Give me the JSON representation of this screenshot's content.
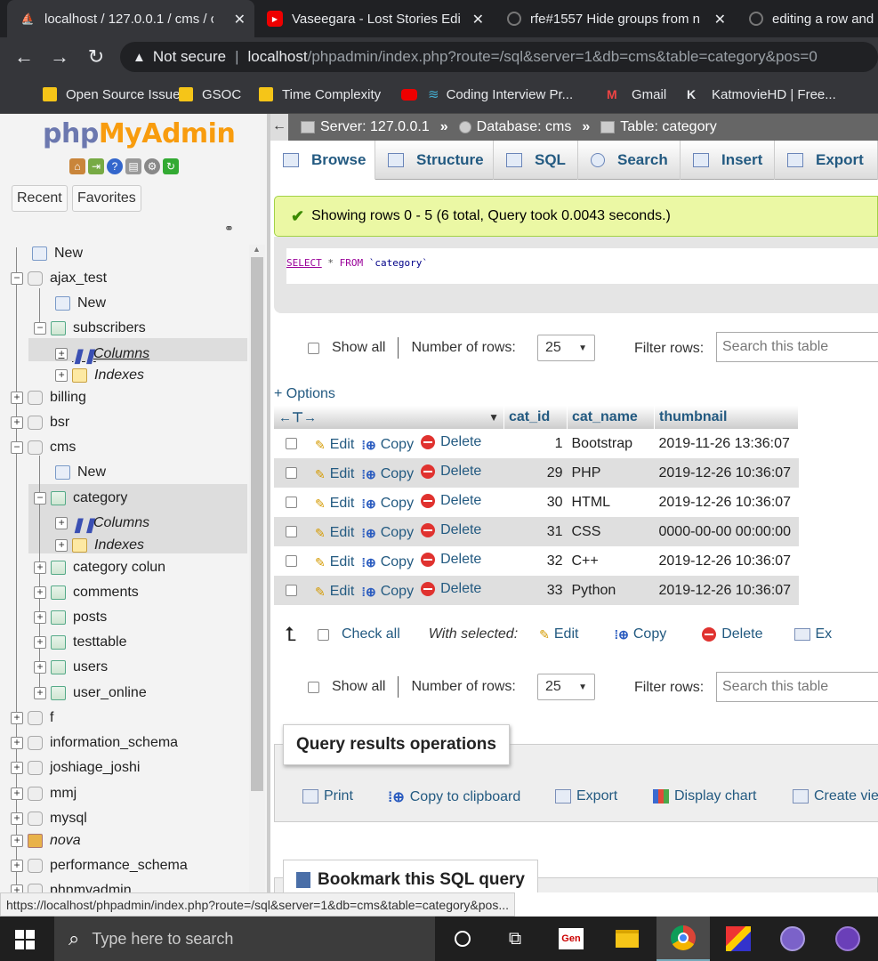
{
  "browser": {
    "tabs": [
      {
        "title": "localhost / 127.0.0.1 / cms / c",
        "icon": "phpmyadmin-icon",
        "active": true
      },
      {
        "title": "Vaseegara - Lost Stories Edit",
        "icon": "youtube-icon",
        "active": false
      },
      {
        "title": "rfe#1557 Hide groups from n",
        "icon": "github-icon",
        "active": false
      },
      {
        "title": "editing a row and",
        "icon": "github-icon",
        "active": false
      }
    ],
    "security_label": "Not secure",
    "url_host": "localhost",
    "url_rest": "/phpadmin/index.php?route=/sql&server=1&db=cms&table=category&pos=0",
    "bookmarks": [
      {
        "label": "Open Source Issues",
        "icon": "folder-icon"
      },
      {
        "label": "GSOC",
        "icon": "folder-icon"
      },
      {
        "label": "Time Complexity",
        "icon": "folder-icon"
      },
      {
        "label": "Coding Interview Pr...",
        "icon": "youtube-icon"
      },
      {
        "label": "Gmail",
        "icon": "gmail-icon"
      },
      {
        "label": "KatmovieHD | Free...",
        "icon": "k-icon"
      }
    ]
  },
  "sidebar": {
    "logo_php": "php",
    "logo_myadmin": "MyAdmin",
    "recent_label": "Recent",
    "favorites_label": "Favorites",
    "tree": [
      {
        "label": "New",
        "level": 0,
        "kind": "new"
      },
      {
        "label": "ajax_test",
        "level": 0,
        "kind": "db",
        "expanded": true
      },
      {
        "label": "New",
        "level": 1,
        "kind": "new"
      },
      {
        "label": "subscribers",
        "level": 1,
        "kind": "table",
        "expanded": true
      },
      {
        "label": "Columns",
        "level": 2,
        "kind": "columns"
      },
      {
        "label": "Indexes",
        "level": 2,
        "kind": "indexes"
      },
      {
        "label": "billing",
        "level": 0,
        "kind": "db"
      },
      {
        "label": "bsr",
        "level": 0,
        "kind": "db"
      },
      {
        "label": "cms",
        "level": 0,
        "kind": "db",
        "expanded": true
      },
      {
        "label": "New",
        "level": 1,
        "kind": "new"
      },
      {
        "label": "category",
        "level": 1,
        "kind": "table",
        "expanded": true
      },
      {
        "label": "Columns",
        "level": 2,
        "kind": "columns"
      },
      {
        "label": "Indexes",
        "level": 2,
        "kind": "indexes"
      },
      {
        "label": "category colun",
        "level": 1,
        "kind": "table"
      },
      {
        "label": "comments",
        "level": 1,
        "kind": "table"
      },
      {
        "label": "posts",
        "level": 1,
        "kind": "table"
      },
      {
        "label": "testtable",
        "level": 1,
        "kind": "table"
      },
      {
        "label": "users",
        "level": 1,
        "kind": "table"
      },
      {
        "label": "user_online",
        "level": 1,
        "kind": "table"
      },
      {
        "label": "f",
        "level": 0,
        "kind": "db"
      },
      {
        "label": "information_schema",
        "level": 0,
        "kind": "db"
      },
      {
        "label": "joshiage_joshi",
        "level": 0,
        "kind": "db"
      },
      {
        "label": "mmj",
        "level": 0,
        "kind": "db"
      },
      {
        "label": "mysql",
        "level": 0,
        "kind": "db"
      },
      {
        "label": "nova",
        "level": 0,
        "kind": "group"
      },
      {
        "label": "performance_schema",
        "level": 0,
        "kind": "db"
      },
      {
        "label": "phpmyadmin",
        "level": 0,
        "kind": "db"
      }
    ]
  },
  "breadcrumb": {
    "server": "Server: 127.0.0.1",
    "database": "Database: cms",
    "table": "Table: category"
  },
  "tabs": [
    {
      "label": "Browse",
      "icon": "browse-icon"
    },
    {
      "label": "Structure",
      "icon": "structure-icon"
    },
    {
      "label": "SQL",
      "icon": "sql-icon"
    },
    {
      "label": "Search",
      "icon": "search-icon"
    },
    {
      "label": "Insert",
      "icon": "insert-icon"
    },
    {
      "label": "Export",
      "icon": "export-icon"
    }
  ],
  "result": {
    "success_message": "Showing rows 0 - 5 (6 total, Query took 0.0043 seconds.)",
    "sql_select": "SELECT",
    "sql_star": "*",
    "sql_from": "FROM",
    "sql_table": "`category`"
  },
  "navigation": {
    "show_all_label": "Show all",
    "rows_label": "Number of rows:",
    "rows_value": "25",
    "filter_label": "Filter rows:",
    "filter_placeholder": "Search this table"
  },
  "options_label": "+ Options",
  "table": {
    "columns": [
      "cat_id",
      "cat_name",
      "thumbnail"
    ],
    "actions": {
      "edit": "Edit",
      "copy": "Copy",
      "delete": "Delete"
    },
    "rows": [
      {
        "cat_id": "1",
        "cat_name": "Bootstrap",
        "thumbnail": "2019-11-26 13:36:07"
      },
      {
        "cat_id": "29",
        "cat_name": "PHP",
        "thumbnail": "2019-12-26 10:36:07"
      },
      {
        "cat_id": "30",
        "cat_name": "HTML",
        "thumbnail": "2019-12-26 10:36:07"
      },
      {
        "cat_id": "31",
        "cat_name": "CSS",
        "thumbnail": "0000-00-00 00:00:00"
      },
      {
        "cat_id": "32",
        "cat_name": "C++",
        "thumbnail": "2019-12-26 10:36:07"
      },
      {
        "cat_id": "33",
        "cat_name": "Python",
        "thumbnail": "2019-12-26 10:36:07"
      }
    ]
  },
  "bulk": {
    "check_all": "Check all",
    "with_selected": "With selected:",
    "edit": "Edit",
    "copy": "Copy",
    "delete": "Delete",
    "export": "Ex"
  },
  "query_ops": {
    "title": "Query results operations",
    "print": "Print",
    "copy_clipboard": "Copy to clipboard",
    "export": "Export",
    "display_chart": "Display chart",
    "create_view": "Create vie"
  },
  "bookmark_title": "Bookmark this SQL query",
  "status_url": "https://localhost/phpadmin/index.php?route=/sql&server=1&db=cms&table=category&pos...",
  "taskbar": {
    "search_placeholder": "Type here to search",
    "icons": [
      "task-view-icon",
      "gen-icon",
      "file-explorer-icon",
      "chrome-icon",
      "paint-icon",
      "tor-icon",
      "github-desktop-icon"
    ]
  }
}
